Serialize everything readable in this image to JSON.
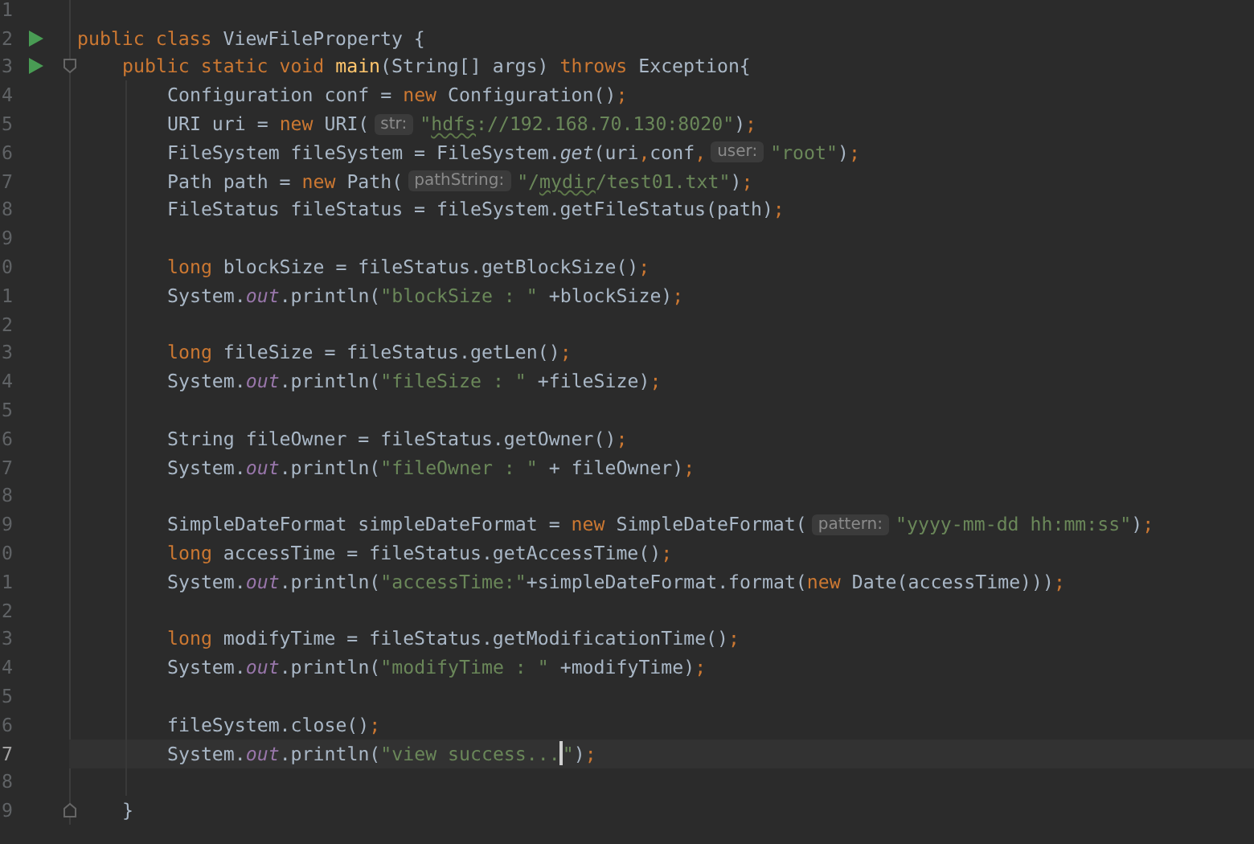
{
  "editor": {
    "lines": [
      {
        "number": "1",
        "kind": "blank"
      },
      {
        "number": "2",
        "kind": "class",
        "run": true,
        "segments": [
          {
            "kind": "code",
            "tokens": [
              {
                "kind": "keyword",
                "text": "public class"
              },
              {
                "kind": "plain",
                "text": " ViewFileProperty {"
              }
            ]
          }
        ]
      },
      {
        "number": "3",
        "kind": "method",
        "run": true,
        "fold_start": true,
        "segments": [
          {
            "kind": "code",
            "tokens": [
              {
                "kind": "keyword",
                "text": "public static void"
              },
              {
                "kind": "declaration",
                "text": " main"
              },
              {
                "kind": "plain",
                "text": "(String[] args) "
              },
              {
                "kind": "keyword",
                "text": "throws"
              },
              {
                "kind": "plain",
                "text": " Exception{"
              }
            ]
          }
        ]
      },
      {
        "number": "4",
        "kind": "body",
        "segments": [
          {
            "kind": "code",
            "tokens": [
              {
                "kind": "plain",
                "text": "Configuration conf = "
              },
              {
                "kind": "keyword",
                "text": "new"
              },
              {
                "kind": "plain",
                "text": " Configuration()"
              },
              {
                "kind": "punct",
                "text": ";"
              }
            ]
          }
        ]
      },
      {
        "number": "5",
        "kind": "body",
        "segments": [
          {
            "kind": "code",
            "tokens": [
              {
                "kind": "plain",
                "text": "URI uri = "
              },
              {
                "kind": "keyword",
                "text": "new"
              },
              {
                "kind": "plain",
                "text": " URI("
              }
            ]
          },
          {
            "kind": "hint",
            "text": "str:"
          },
          {
            "kind": "code",
            "tokens": [
              {
                "kind": "string",
                "text": "\""
              },
              {
                "kind": "typo",
                "text": "hdfs"
              },
              {
                "kind": "string",
                "text": "://192.168.70.130:8020\""
              },
              {
                "kind": "plain",
                "text": ")"
              },
              {
                "kind": "punct",
                "text": ";"
              }
            ]
          }
        ]
      },
      {
        "number": "6",
        "kind": "body",
        "segments": [
          {
            "kind": "code",
            "tokens": [
              {
                "kind": "plain",
                "text": "FileSystem fileSystem = FileSystem."
              },
              {
                "kind": "static-method",
                "text": "get"
              },
              {
                "kind": "plain",
                "text": "(uri"
              },
              {
                "kind": "punct",
                "text": ","
              },
              {
                "kind": "plain",
                "text": "conf"
              },
              {
                "kind": "punct",
                "text": ","
              }
            ]
          },
          {
            "kind": "hint",
            "text": "user:"
          },
          {
            "kind": "code",
            "tokens": [
              {
                "kind": "string",
                "text": "\"root\""
              },
              {
                "kind": "plain",
                "text": ")"
              },
              {
                "kind": "punct",
                "text": ";"
              }
            ]
          }
        ]
      },
      {
        "number": "7",
        "kind": "body",
        "segments": [
          {
            "kind": "code",
            "tokens": [
              {
                "kind": "plain",
                "text": "Path path = "
              },
              {
                "kind": "keyword",
                "text": "new"
              },
              {
                "kind": "plain",
                "text": " Path("
              }
            ]
          },
          {
            "kind": "hint",
            "text": "pathString:"
          },
          {
            "kind": "code",
            "tokens": [
              {
                "kind": "string",
                "text": "\"/"
              },
              {
                "kind": "typo",
                "text": "mydir"
              },
              {
                "kind": "string",
                "text": "/test01.txt\""
              },
              {
                "kind": "plain",
                "text": ")"
              },
              {
                "kind": "punct",
                "text": ";"
              }
            ]
          }
        ]
      },
      {
        "number": "8",
        "kind": "body",
        "segments": [
          {
            "kind": "code",
            "tokens": [
              {
                "kind": "plain",
                "text": "FileStatus fileStatus = fileSystem.getFileStatus(path)"
              },
              {
                "kind": "punct",
                "text": ";"
              }
            ]
          }
        ]
      },
      {
        "number": "9",
        "kind": "body"
      },
      {
        "number": "0",
        "kind": "body",
        "segments": [
          {
            "kind": "code",
            "tokens": [
              {
                "kind": "keyword",
                "text": "long"
              },
              {
                "kind": "plain",
                "text": " blockSize = fileStatus.getBlockSize()"
              },
              {
                "kind": "punct",
                "text": ";"
              }
            ]
          }
        ]
      },
      {
        "number": "1",
        "kind": "body",
        "segments": [
          {
            "kind": "code",
            "tokens": [
              {
                "kind": "plain",
                "text": "System."
              },
              {
                "kind": "static-field",
                "text": "out"
              },
              {
                "kind": "plain",
                "text": ".println("
              },
              {
                "kind": "string",
                "text": "\"blockSize : \""
              },
              {
                "kind": "plain",
                "text": " +blockSize)"
              },
              {
                "kind": "punct",
                "text": ";"
              }
            ]
          }
        ]
      },
      {
        "number": "2",
        "kind": "body"
      },
      {
        "number": "3",
        "kind": "body",
        "segments": [
          {
            "kind": "code",
            "tokens": [
              {
                "kind": "keyword",
                "text": "long"
              },
              {
                "kind": "plain",
                "text": " fileSize = fileStatus.getLen()"
              },
              {
                "kind": "punct",
                "text": ";"
              }
            ]
          }
        ]
      },
      {
        "number": "4",
        "kind": "body",
        "segments": [
          {
            "kind": "code",
            "tokens": [
              {
                "kind": "plain",
                "text": "System."
              },
              {
                "kind": "static-field",
                "text": "out"
              },
              {
                "kind": "plain",
                "text": ".println("
              },
              {
                "kind": "string",
                "text": "\"fileSize : \""
              },
              {
                "kind": "plain",
                "text": " +fileSize)"
              },
              {
                "kind": "punct",
                "text": ";"
              }
            ]
          }
        ]
      },
      {
        "number": "5",
        "kind": "body"
      },
      {
        "number": "6",
        "kind": "body",
        "segments": [
          {
            "kind": "code",
            "tokens": [
              {
                "kind": "plain",
                "text": "String fileOwner = fileStatus.getOwner()"
              },
              {
                "kind": "punct",
                "text": ";"
              }
            ]
          }
        ]
      },
      {
        "number": "7",
        "kind": "body",
        "segments": [
          {
            "kind": "code",
            "tokens": [
              {
                "kind": "plain",
                "text": "System."
              },
              {
                "kind": "static-field",
                "text": "out"
              },
              {
                "kind": "plain",
                "text": ".println("
              },
              {
                "kind": "string",
                "text": "\"fileOwner : \""
              },
              {
                "kind": "plain",
                "text": " + fileOwner)"
              },
              {
                "kind": "punct",
                "text": ";"
              }
            ]
          }
        ]
      },
      {
        "number": "8",
        "kind": "body"
      },
      {
        "number": "9",
        "kind": "body",
        "segments": [
          {
            "kind": "code",
            "tokens": [
              {
                "kind": "plain",
                "text": "SimpleDateFormat simpleDateFormat = "
              },
              {
                "kind": "keyword",
                "text": "new"
              },
              {
                "kind": "plain",
                "text": " SimpleDateFormat("
              }
            ]
          },
          {
            "kind": "hint",
            "text": "pattern:"
          },
          {
            "kind": "code",
            "tokens": [
              {
                "kind": "string",
                "text": "\"yyyy-mm-dd hh:mm:ss\""
              },
              {
                "kind": "plain",
                "text": ")"
              },
              {
                "kind": "punct",
                "text": ";"
              }
            ]
          }
        ]
      },
      {
        "number": "0",
        "kind": "body",
        "segments": [
          {
            "kind": "code",
            "tokens": [
              {
                "kind": "keyword",
                "text": "long"
              },
              {
                "kind": "plain",
                "text": " accessTime = fileStatus.getAccessTime()"
              },
              {
                "kind": "punct",
                "text": ";"
              }
            ]
          }
        ]
      },
      {
        "number": "1",
        "kind": "body",
        "segments": [
          {
            "kind": "code",
            "tokens": [
              {
                "kind": "plain",
                "text": "System."
              },
              {
                "kind": "static-field",
                "text": "out"
              },
              {
                "kind": "plain",
                "text": ".println("
              },
              {
                "kind": "string",
                "text": "\"accessTime:\""
              },
              {
                "kind": "plain",
                "text": "+simpleDateFormat.format("
              },
              {
                "kind": "keyword",
                "text": "new"
              },
              {
                "kind": "plain",
                "text": " Date(accessTime)))"
              },
              {
                "kind": "punct",
                "text": ";"
              }
            ]
          }
        ]
      },
      {
        "number": "2",
        "kind": "body"
      },
      {
        "number": "3",
        "kind": "body",
        "segments": [
          {
            "kind": "code",
            "tokens": [
              {
                "kind": "keyword",
                "text": "long"
              },
              {
                "kind": "plain",
                "text": " modifyTime = fileStatus.getModificationTime()"
              },
              {
                "kind": "punct",
                "text": ";"
              }
            ]
          }
        ]
      },
      {
        "number": "4",
        "kind": "body",
        "segments": [
          {
            "kind": "code",
            "tokens": [
              {
                "kind": "plain",
                "text": "System."
              },
              {
                "kind": "static-field",
                "text": "out"
              },
              {
                "kind": "plain",
                "text": ".println("
              },
              {
                "kind": "string",
                "text": "\"modifyTime : \""
              },
              {
                "kind": "plain",
                "text": " +modifyTime)"
              },
              {
                "kind": "punct",
                "text": ";"
              }
            ]
          }
        ]
      },
      {
        "number": "5",
        "kind": "body"
      },
      {
        "number": "6",
        "kind": "body",
        "segments": [
          {
            "kind": "code",
            "tokens": [
              {
                "kind": "plain",
                "text": "fileSystem.close()"
              },
              {
                "kind": "punct",
                "text": ";"
              }
            ]
          }
        ]
      },
      {
        "number": "7",
        "kind": "body",
        "current": true,
        "segments": [
          {
            "kind": "code",
            "tokens": [
              {
                "kind": "plain",
                "text": "System."
              },
              {
                "kind": "static-field",
                "text": "out"
              },
              {
                "kind": "plain",
                "text": ".println("
              },
              {
                "kind": "string",
                "text": "\"view success..."
              }
            ]
          },
          {
            "kind": "caret"
          },
          {
            "kind": "code",
            "tokens": [
              {
                "kind": "string",
                "text": "\""
              },
              {
                "kind": "plain",
                "text": ")"
              },
              {
                "kind": "punct",
                "text": ";"
              }
            ]
          }
        ]
      },
      {
        "number": "8",
        "kind": "body"
      },
      {
        "number": "9",
        "kind": "method",
        "fold_end": true,
        "segments": [
          {
            "kind": "code",
            "tokens": [
              {
                "kind": "plain",
                "text": "}"
              }
            ]
          }
        ]
      }
    ]
  }
}
